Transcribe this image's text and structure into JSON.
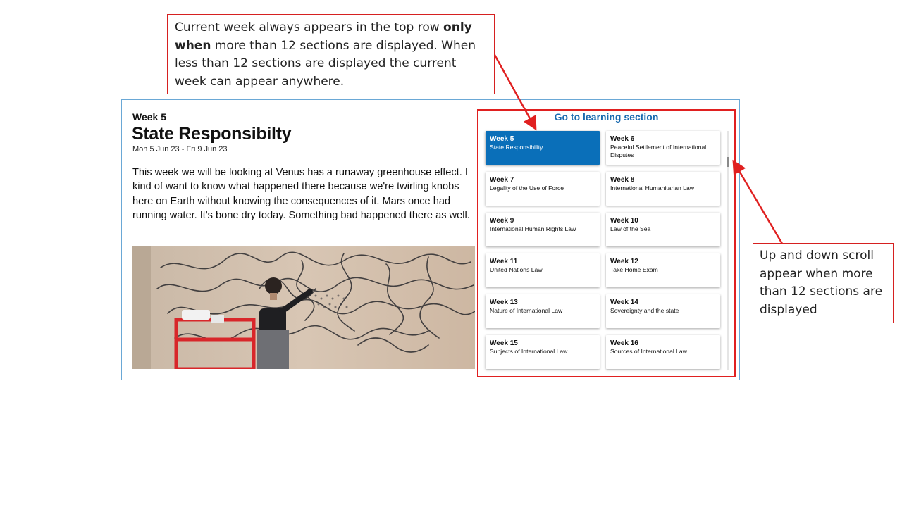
{
  "annotations": {
    "top_note": {
      "pre": "Current week always appears in the top row ",
      "bold1": "only when",
      "post": " more than 12 sections are displayed. When less than 12 sections are displayed the current week can appear anywhere."
    },
    "right_note": "Up and down scroll appear when more than 12 sections are displayed",
    "arrow_color": "#e02020"
  },
  "week_panel": {
    "kicker": "Week 5",
    "title": "State Responsibilty",
    "dates": "Mon 5 Jun 23 - Fri 9 Jun 23",
    "description": "This week we will be looking at Venus has a runaway greenhouse effect. I kind of want to know what happened there because we're twirling knobs here on Earth without knowing the consequences of it. Mars once had running water. It's bone dry today. Something bad happened there as well."
  },
  "nav": {
    "title": "Go to learning section",
    "title_color": "#1b6bb0",
    "active_color": "#0a6fb9",
    "cards": [
      {
        "week": "Week 5",
        "topic": "State Responsibility",
        "active": true
      },
      {
        "week": "Week 6",
        "topic": "Peaceful Settlement of International Disputes",
        "active": false
      },
      {
        "week": "Week 7",
        "topic": "Legality of the Use of Force",
        "active": false
      },
      {
        "week": "Week 8",
        "topic": "International Humanitarian Law",
        "active": false
      },
      {
        "week": "Week 9",
        "topic": "International Human Rights Law",
        "active": false
      },
      {
        "week": "Week 10",
        "topic": "Law of the Sea",
        "active": false
      },
      {
        "week": "Week 11",
        "topic": "United Nations Law",
        "active": false
      },
      {
        "week": "Week 12",
        "topic": "Take Home Exam",
        "active": false
      },
      {
        "week": "Week 13",
        "topic": "Nature of International Law",
        "active": false
      },
      {
        "week": "Week 14",
        "topic": "Sovereignty and the state",
        "active": false
      },
      {
        "week": "Week 15",
        "topic": "Subjects of International Law",
        "active": false
      },
      {
        "week": "Week 16",
        "topic": "Sources of International Law",
        "active": false
      }
    ]
  }
}
